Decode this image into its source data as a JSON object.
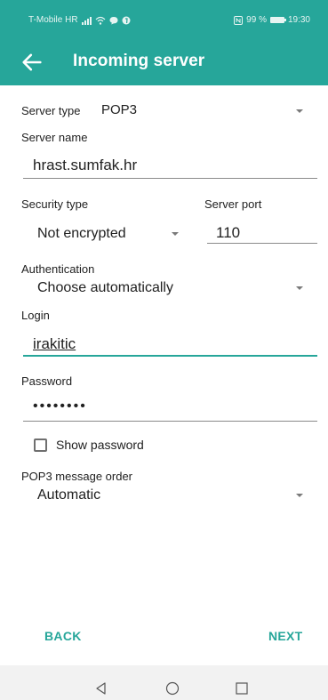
{
  "status_bar": {
    "carrier": "T-Mobile HR",
    "battery_text": "99 %",
    "time": "19:30"
  },
  "app_bar": {
    "title": "Incoming server",
    "back_icon": "arrow-left-icon"
  },
  "form": {
    "server_type_label": "Server type",
    "server_type_value": "POP3",
    "server_name_label": "Server name",
    "server_name_value": "hrast.sumfak.hr",
    "security_type_label": "Security type",
    "security_type_value": "Not encrypted",
    "server_port_label": "Server port",
    "server_port_value": "110",
    "authentication_label": "Authentication",
    "authentication_value": "Choose automatically",
    "login_label": "Login",
    "login_value": "irakitic",
    "password_label": "Password",
    "password_value": "••••••••",
    "show_password_label": "Show password",
    "show_password_checked": false,
    "message_order_label": "POP3 message order",
    "message_order_value": "Automatic"
  },
  "buttons": {
    "back": "BACK",
    "next": "NEXT"
  },
  "colors": {
    "accent": "#26a69a"
  }
}
